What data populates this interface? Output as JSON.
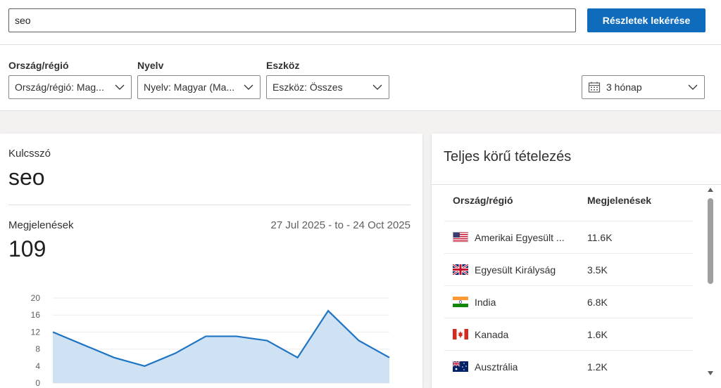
{
  "search": {
    "value": "seo",
    "button_label": "Részletek lekérése"
  },
  "filters": {
    "country": {
      "label": "Ország/régió",
      "value": "Ország/régió: Mag..."
    },
    "language": {
      "label": "Nyelv",
      "value": "Nyelv: Magyar (Ma..."
    },
    "device": {
      "label": "Eszköz",
      "value": "Eszköz: Összes"
    },
    "period": {
      "value": "3 hónap",
      "icon": "calendar-icon"
    }
  },
  "keyword_card": {
    "keyword_label": "Kulcsszó",
    "keyword": "seo",
    "impressions_label": "Megjelenések",
    "date_range": "27 Jul 2025 - to - 24 Oct 2025",
    "impressions": "109"
  },
  "chart_data": {
    "type": "area",
    "x": [
      1,
      2,
      3,
      4,
      5,
      6,
      7,
      8,
      9,
      10,
      11,
      12
    ],
    "values": [
      12,
      9,
      6,
      4,
      7,
      11,
      11,
      10,
      6,
      17,
      10,
      6
    ],
    "y_ticks": [
      "20",
      "16",
      "12",
      "8",
      "4",
      "0"
    ],
    "ylim": [
      0,
      20
    ],
    "grid": true,
    "line_color": "#1f75c4",
    "fill_color": "#cfe2f3"
  },
  "breakdown": {
    "title": "Teljes körű tételezés",
    "col_country": "Ország/régió",
    "col_impressions": "Megjelenések",
    "rows": [
      {
        "country": "Amerikai Egyesült ...",
        "impressions": "11.6K",
        "flag": "us-flag-icon"
      },
      {
        "country": "Egyesült Királyság",
        "impressions": "3.5K",
        "flag": "uk-flag-icon"
      },
      {
        "country": "India",
        "impressions": "6.8K",
        "flag": "india-flag-icon"
      },
      {
        "country": "Kanada",
        "impressions": "1.6K",
        "flag": "canada-flag-icon"
      },
      {
        "country": "Ausztrália",
        "impressions": "1.2K",
        "flag": "australia-flag-icon"
      }
    ]
  },
  "colors": {
    "accent": "#0f6cbd"
  }
}
